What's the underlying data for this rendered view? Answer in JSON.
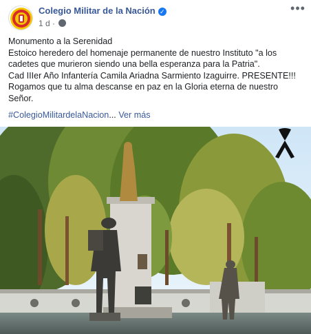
{
  "post": {
    "page_name": "Colegio Militar de la Nación",
    "verified_icon": "verified-badge-icon",
    "time": "1 d",
    "separator": " · ",
    "audience_icon": "globe-icon",
    "more_icon": "more-options-icon",
    "more_label": "•••",
    "paragraphs": [
      "Monumento a la Serenidad",
      "Estoico heredero del homenaje permanente de nuestro Instituto \"a los cadetes que murieron siendo una bella esperanza para la Patria\".",
      "Cad IIIer Año Infantería Camila Ariadna Sarmiento Izaguirre. PRESENTE!!!",
      "Rogamos que tu alma descanse en paz en la Gloria eterna de nuestro Señor."
    ],
    "hashtag": "#ColegioMilitardelaNacion",
    "ellipsis": "... ",
    "see_more": "Ver más",
    "mourning_icon": "mourning-ribbon-icon"
  },
  "colors": {
    "link": "#385898",
    "text": "#1c1e21",
    "meta": "#606770",
    "verified": "#1877f2"
  }
}
